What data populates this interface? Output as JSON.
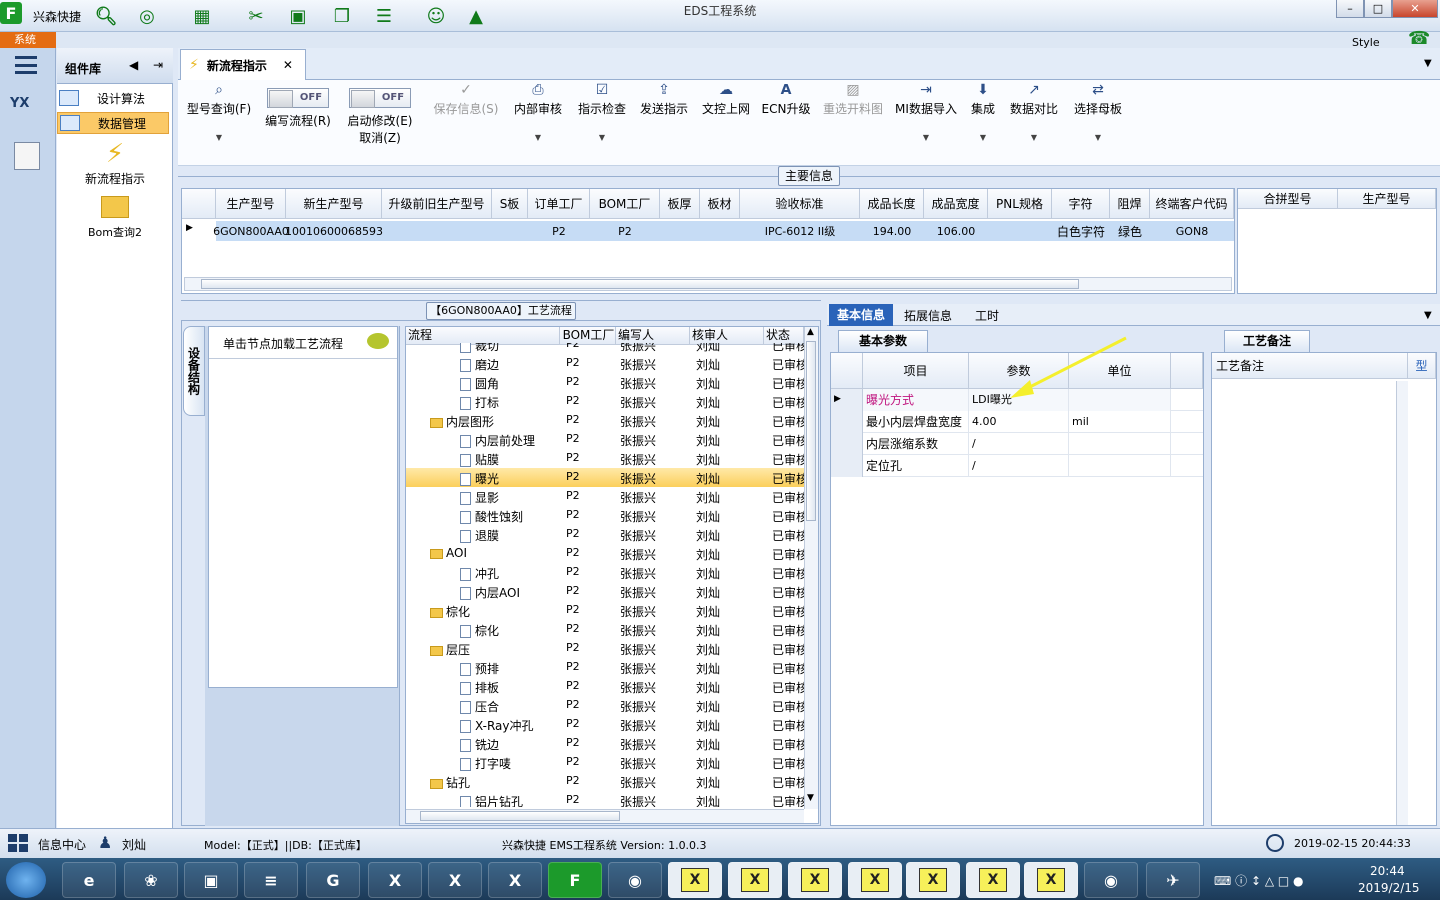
{
  "titlebar": {
    "app_name": "兴森快捷",
    "window_title": "EDS工程系统"
  },
  "menu": {
    "system_tab": "系统",
    "style_label": "Style"
  },
  "complib": {
    "title": "组件库",
    "items": [
      "设计算法",
      "数据管理"
    ],
    "tools": [
      "新流程指示",
      "Bom查询2"
    ]
  },
  "doctab": {
    "label": "新流程指示"
  },
  "toolbar": {
    "btn_query": "型号查询(F)",
    "edit_flow": "编写流程(R)",
    "start_modify": "启动修改(E)",
    "cancel": "取消(Z)",
    "toggle_off": "OFF",
    "save_info": "保存信息(S)",
    "internal_review": "内部审核",
    "indicate_check": "指示检查",
    "send_indicate": "发送指示",
    "upload": "文控上网",
    "ecn": "ECN升级",
    "reselect": "重选开料图",
    "mi_import": "MI数据导入",
    "integrate": "集成",
    "compare": "数据对比",
    "select_board": "选择母板"
  },
  "main_info": {
    "title": "主要信息",
    "headers": [
      "生产型号",
      "新生产型号",
      "升级前旧生产型号",
      "S板",
      "订单工厂",
      "BOM工厂",
      "板厚",
      "板材",
      "验收标准",
      "成品长度",
      "成品宽度",
      "PNL规格",
      "字符",
      "阻焊",
      "终端客户代码"
    ],
    "row": [
      "6GON800AA0",
      "10010600068593",
      "",
      "",
      "P2",
      "P2",
      "",
      "",
      "IPC-6012 II级",
      "194.00",
      "106.00",
      "",
      "白色字符",
      "绿色",
      "GON8"
    ],
    "right_headers": [
      "合拼型号",
      "生产型号"
    ]
  },
  "flow_panel": {
    "title": "【6GON800AA0】工艺流程",
    "vert_tab": "设备结构",
    "hint": "单击节点加载工艺流程",
    "headers": [
      "流程",
      "BOM工厂",
      "编写人",
      "核审人",
      "状态"
    ],
    "rows": [
      {
        "name": "裁切",
        "level": 2,
        "bom": "P2",
        "writer": "张振兴",
        "checker": "刘灿",
        "status": "已审核"
      },
      {
        "name": "磨边",
        "level": 2,
        "bom": "P2",
        "writer": "张振兴",
        "checker": "刘灿",
        "status": "已审核"
      },
      {
        "name": "圆角",
        "level": 2,
        "bom": "P2",
        "writer": "张振兴",
        "checker": "刘灿",
        "status": "已审核"
      },
      {
        "name": "打标",
        "level": 2,
        "bom": "P2",
        "writer": "张振兴",
        "checker": "刘灿",
        "status": "已审核"
      },
      {
        "name": "内层图形",
        "level": 1,
        "bom": "P2",
        "writer": "张振兴",
        "checker": "刘灿",
        "status": "已审核"
      },
      {
        "name": "内层前处理",
        "level": 2,
        "bom": "P2",
        "writer": "张振兴",
        "checker": "刘灿",
        "status": "已审核"
      },
      {
        "name": "贴膜",
        "level": 2,
        "bom": "P2",
        "writer": "张振兴",
        "checker": "刘灿",
        "status": "已审核"
      },
      {
        "name": "曝光",
        "level": 2,
        "bom": "P2",
        "writer": "张振兴",
        "checker": "刘灿",
        "status": "已审核"
      },
      {
        "name": "显影",
        "level": 2,
        "bom": "P2",
        "writer": "张振兴",
        "checker": "刘灿",
        "status": "已审核"
      },
      {
        "name": "酸性蚀刻",
        "level": 2,
        "bom": "P2",
        "writer": "张振兴",
        "checker": "刘灿",
        "status": "已审核"
      },
      {
        "name": "退膜",
        "level": 2,
        "bom": "P2",
        "writer": "张振兴",
        "checker": "刘灿",
        "status": "已审核"
      },
      {
        "name": "AOI",
        "level": 1,
        "bom": "P2",
        "writer": "张振兴",
        "checker": "刘灿",
        "status": "已审核"
      },
      {
        "name": "冲孔",
        "level": 2,
        "bom": "P2",
        "writer": "张振兴",
        "checker": "刘灿",
        "status": "已审核"
      },
      {
        "name": "内层AOI",
        "level": 2,
        "bom": "P2",
        "writer": "张振兴",
        "checker": "刘灿",
        "status": "已审核"
      },
      {
        "name": "棕化",
        "level": 1,
        "bom": "P2",
        "writer": "张振兴",
        "checker": "刘灿",
        "status": "已审核"
      },
      {
        "name": "棕化",
        "level": 2,
        "bom": "P2",
        "writer": "张振兴",
        "checker": "刘灿",
        "status": "已审核"
      },
      {
        "name": "层压",
        "level": 1,
        "bom": "P2",
        "writer": "张振兴",
        "checker": "刘灿",
        "status": "已审核"
      },
      {
        "name": "预排",
        "level": 2,
        "bom": "P2",
        "writer": "张振兴",
        "checker": "刘灿",
        "status": "已审核"
      },
      {
        "name": "排板",
        "level": 2,
        "bom": "P2",
        "writer": "张振兴",
        "checker": "刘灿",
        "status": "已审核"
      },
      {
        "name": "压合",
        "level": 2,
        "bom": "P2",
        "writer": "张振兴",
        "checker": "刘灿",
        "status": "已审核"
      },
      {
        "name": "X-Ray冲孔",
        "level": 2,
        "bom": "P2",
        "writer": "张振兴",
        "checker": "刘灿",
        "status": "已审核"
      },
      {
        "name": "铣边",
        "level": 2,
        "bom": "P2",
        "writer": "张振兴",
        "checker": "刘灿",
        "status": "已审核"
      },
      {
        "name": "打字唛",
        "level": 2,
        "bom": "P2",
        "writer": "张振兴",
        "checker": "刘灿",
        "status": "已审核"
      },
      {
        "name": "钻孔",
        "level": 1,
        "bom": "P2",
        "writer": "张振兴",
        "checker": "刘灿",
        "status": "已审核"
      },
      {
        "name": "铝片钻孔",
        "level": 2,
        "bom": "P2",
        "writer": "张振兴",
        "checker": "刘灿",
        "status": "已审核"
      }
    ],
    "selected_index": 7
  },
  "detail": {
    "tabs": [
      "基本信息",
      "拓展信息",
      "工时"
    ],
    "subtab": "基本参数",
    "param_headers": [
      "项目",
      "参数",
      "单位"
    ],
    "params": [
      {
        "item": "曝光方式",
        "value": "LDI曝光",
        "unit": ""
      },
      {
        "item": "最小内层焊盘宽度",
        "value": "4.00",
        "unit": "mil"
      },
      {
        "item": "内层涨缩系数",
        "value": "/",
        "unit": ""
      },
      {
        "item": "定位孔",
        "value": "/",
        "unit": ""
      }
    ],
    "note_tab": "工艺备注",
    "note_header": "工艺备注",
    "note_col2": "型"
  },
  "status": {
    "info_center": "信息中心",
    "user": "刘灿",
    "model": "Model:【正式】||DB:【正式库】",
    "version": "兴森快捷 EMS工程系统 Version: 1.0.0.3",
    "datetime": "2019-02-15 20:44:33"
  },
  "taskbar": {
    "time": "20:44",
    "date": "2019/2/15"
  }
}
